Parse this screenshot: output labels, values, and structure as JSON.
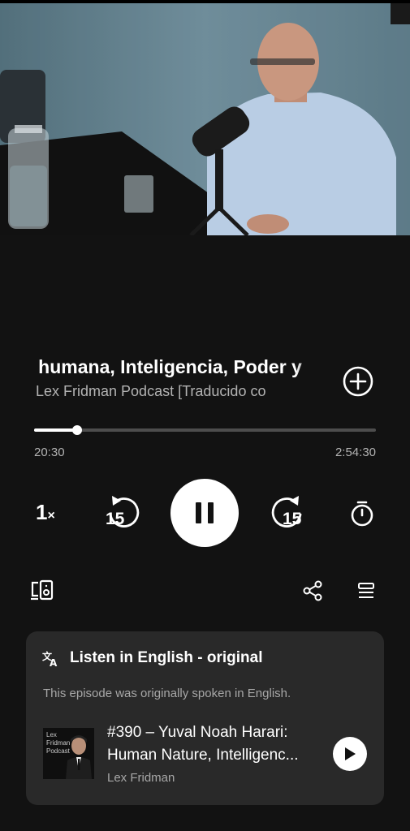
{
  "video": {
    "description_icon": "video-frame"
  },
  "episode": {
    "title_visible": "a humana, Inteligencia, Poder y",
    "subtitle_visible": "Lex Fridman Podcast  [Traducido co"
  },
  "progress": {
    "elapsed": "20:30",
    "total": "2:54:30",
    "fraction": 0.1266
  },
  "controls": {
    "speed": "1",
    "speed_suffix": "×",
    "skip_back": "15",
    "skip_forward": "15"
  },
  "card": {
    "heading": "Listen in English - original",
    "description": "This episode was originally spoken in English.",
    "thumb_text": "Lex Fridman Podcast",
    "episode_line1": "#390 – Yuval Noah Harari:",
    "episode_line2": "Human Nature, Intelligenc...",
    "author": "Lex Fridman"
  }
}
